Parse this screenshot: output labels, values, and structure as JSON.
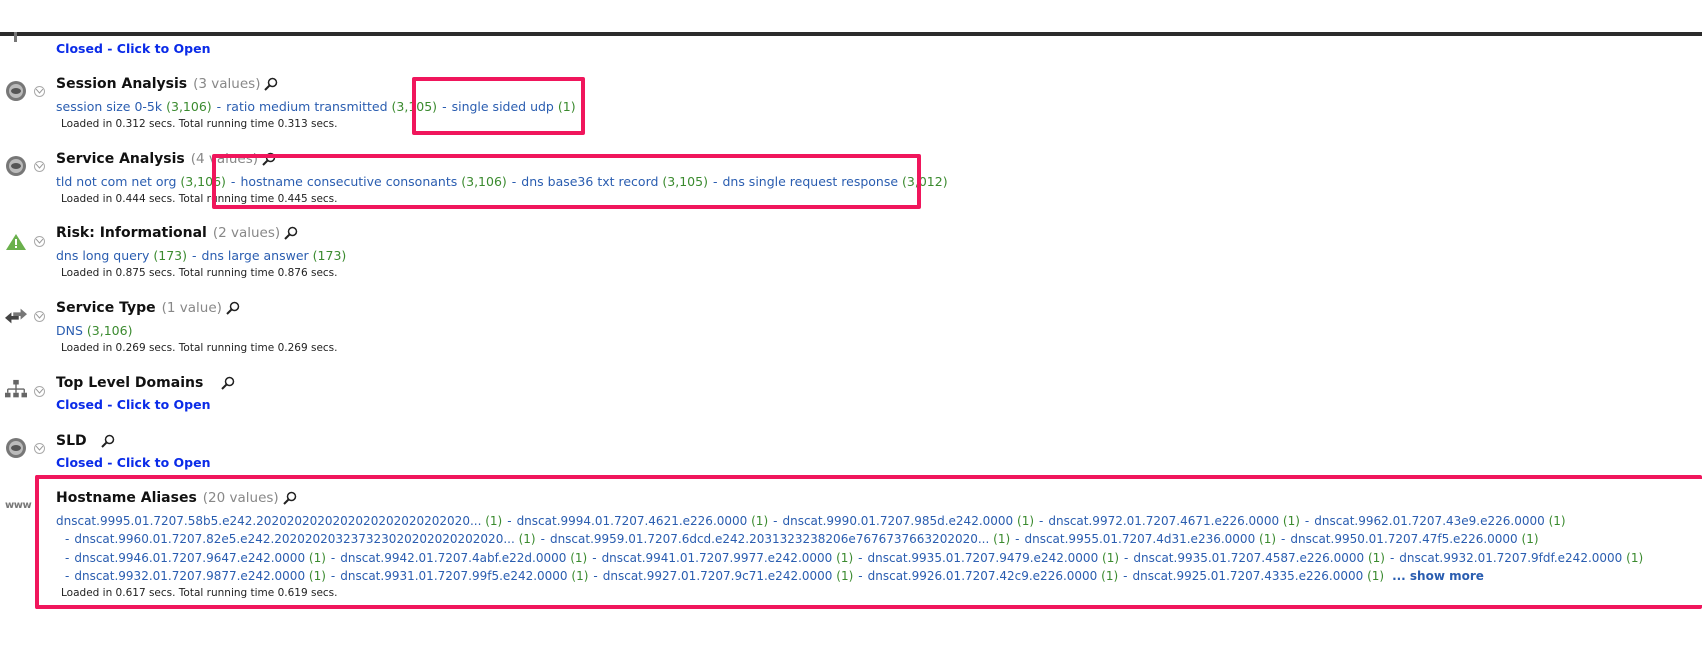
{
  "groups": {
    "top_partial": {
      "closed_label": "Closed - Click to Open"
    },
    "session_analysis": {
      "title": "Session Analysis",
      "count": "(3 values)",
      "values": [
        {
          "label": "session size 0-5k",
          "count": "(3,106)"
        },
        {
          "label": "ratio medium transmitted",
          "count": "(3,105)"
        },
        {
          "label": "single sided udp",
          "count": "(1)"
        }
      ],
      "loaded": "Loaded in 0.312 secs. Total running time 0.313 secs."
    },
    "service_analysis": {
      "title": "Service Analysis",
      "count": "(4 values)",
      "values": [
        {
          "label": "tld not com net org",
          "count": "(3,106)"
        },
        {
          "label": "hostname consecutive consonants",
          "count": "(3,106)"
        },
        {
          "label": "dns base36 txt record",
          "count": "(3,105)"
        },
        {
          "label": "dns single request response",
          "count": "(3,012)"
        }
      ],
      "loaded": "Loaded in 0.444 secs. Total running time 0.445 secs."
    },
    "risk_informational": {
      "title": "Risk: Informational",
      "count": "(2 values)",
      "values": [
        {
          "label": "dns long query",
          "count": "(173)"
        },
        {
          "label": "dns large answer",
          "count": "(173)"
        }
      ],
      "loaded": "Loaded in 0.875 secs. Total running time 0.876 secs."
    },
    "service_type": {
      "title": "Service Type",
      "count": "(1 value)",
      "values": [
        {
          "label": "DNS",
          "count": "(3,106)"
        }
      ],
      "loaded": "Loaded in 0.269 secs. Total running time 0.269 secs."
    },
    "top_level_domains": {
      "title": "Top Level Domains",
      "closed_label": "Closed - Click to Open"
    },
    "sld": {
      "title": "SLD",
      "closed_label": "Closed - Click to Open"
    },
    "hostname_aliases": {
      "title": "Hostname Aliases",
      "count": "(20 values)",
      "www_label": "www",
      "rows": [
        [
          {
            "label": "dnscat.9995.01.7207.58b5.e242.2020202020202020202020202020...",
            "count": "(1)"
          },
          {
            "label": "dnscat.9994.01.7207.4621.e226.0000",
            "count": "(1)"
          },
          {
            "label": "dnscat.9990.01.7207.985d.e242.0000",
            "count": "(1)"
          },
          {
            "label": "dnscat.9972.01.7207.4671.e226.0000",
            "count": "(1)"
          },
          {
            "label": "dnscat.9962.01.7207.43e9.e226.0000",
            "count": "(1)"
          }
        ],
        [
          {
            "label": "dnscat.9960.01.7207.82e5.e242.202020203237323020202020202020...",
            "count": "(1)"
          },
          {
            "label": "dnscat.9959.01.7207.6dcd.e242.2031323238206e7676737663202020...",
            "count": "(1)"
          },
          {
            "label": "dnscat.9955.01.7207.4d31.e236.0000",
            "count": "(1)"
          },
          {
            "label": "dnscat.9950.01.7207.47f5.e226.0000",
            "count": "(1)"
          }
        ],
        [
          {
            "label": "dnscat.9946.01.7207.9647.e242.0000",
            "count": "(1)"
          },
          {
            "label": "dnscat.9942.01.7207.4abf.e22d.0000",
            "count": "(1)"
          },
          {
            "label": "dnscat.9941.01.7207.9977.e242.0000",
            "count": "(1)"
          },
          {
            "label": "dnscat.9935.01.7207.9479.e242.0000",
            "count": "(1)"
          },
          {
            "label": "dnscat.9935.01.7207.4587.e226.0000",
            "count": "(1)"
          },
          {
            "label": "dnscat.9932.01.7207.9fdf.e242.0000",
            "count": "(1)"
          }
        ],
        [
          {
            "label": "dnscat.9932.01.7207.9877.e242.0000",
            "count": "(1)"
          },
          {
            "label": "dnscat.9931.01.7207.99f5.e242.0000",
            "count": "(1)"
          },
          {
            "label": "dnscat.9927.01.7207.9c71.e242.0000",
            "count": "(1)"
          },
          {
            "label": "dnscat.9926.01.7207.42c9.e226.0000",
            "count": "(1)"
          },
          {
            "label": "dnscat.9925.01.7207.4335.e226.0000",
            "count": "(1)"
          }
        ]
      ],
      "show_more": "... show more",
      "loaded": "Loaded in 0.617 secs. Total running time 0.619 secs."
    }
  },
  "colors": {
    "link": "#2a5db0",
    "count": "#3a8a2e",
    "closed": "#0a2be8",
    "highlight": "#f0165c"
  }
}
